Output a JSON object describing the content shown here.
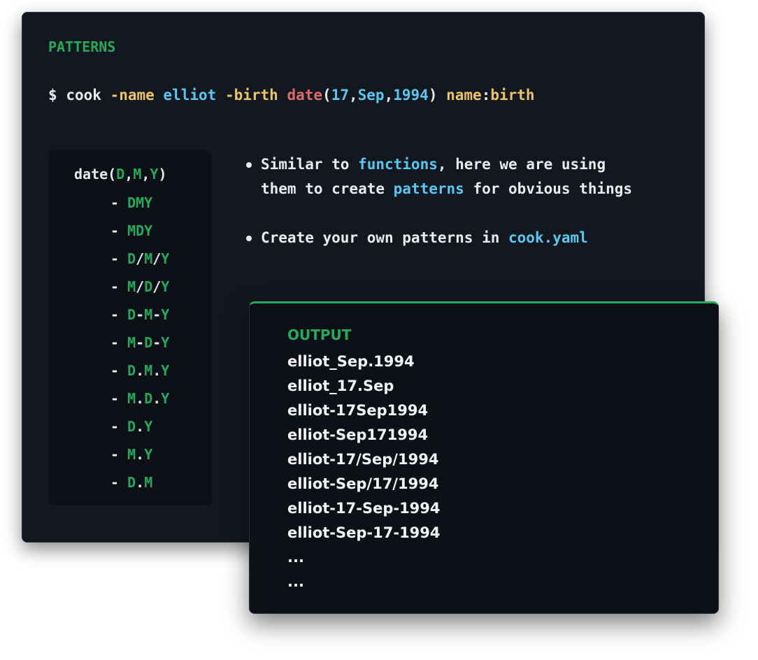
{
  "patterns_title": "PATTERNS",
  "command": {
    "prompt": "$",
    "cmd": "cook",
    "flag_name": "-name",
    "name_value": "elliot",
    "flag_birth": "-birth",
    "fn": "date",
    "open": "(",
    "day": "17",
    "comma1": ",",
    "month": "Sep",
    "comma2": ",",
    "year": "1994",
    "close": ")",
    "name_key": "name",
    "colon": ":",
    "birth_key": "birth"
  },
  "signature": {
    "fn": "date(",
    "d": "D",
    "comma1": ",",
    "m": "M",
    "comma2": ",",
    "y": "Y",
    "close": ")"
  },
  "patterns": [
    {
      "dash": "- ",
      "parts": [
        "DMY"
      ]
    },
    {
      "dash": "- ",
      "parts": [
        "MDY"
      ]
    },
    {
      "dash": "- ",
      "parts": [
        "D",
        "/",
        "M",
        "/",
        "Y"
      ]
    },
    {
      "dash": "- ",
      "parts": [
        "M",
        "/",
        "D",
        "/",
        "Y"
      ]
    },
    {
      "dash": "- ",
      "parts": [
        "D",
        "-",
        "M",
        "-",
        "Y"
      ]
    },
    {
      "dash": "- ",
      "parts": [
        "M",
        "-",
        "D",
        "-",
        "Y"
      ]
    },
    {
      "dash": "- ",
      "parts": [
        "D",
        ".",
        "M",
        ".",
        "Y"
      ]
    },
    {
      "dash": "- ",
      "parts": [
        "M",
        ".",
        "D",
        ".",
        "Y"
      ]
    },
    {
      "dash": "- ",
      "parts": [
        "D",
        ".",
        "Y"
      ]
    },
    {
      "dash": "- ",
      "parts": [
        "M",
        ".",
        "Y"
      ]
    },
    {
      "dash": "- ",
      "parts": [
        "D",
        ".",
        "M"
      ]
    }
  ],
  "bullets": {
    "b1": {
      "t1": "Similar to ",
      "h1": "functions",
      "t2": ", here we are using",
      "t3": "them to create ",
      "h2": "patterns",
      "t4": " for obvious things"
    },
    "b2": {
      "t1": "Create your own patterns in ",
      "h1": "cook.yaml"
    }
  },
  "output": {
    "title": "OUTPUT",
    "lines": [
      "elliot_Sep.1994",
      "elliot_17.Sep",
      "elliot-17Sep1994",
      "elliot-Sep171994",
      "elliot-17/Sep/1994",
      "elliot-Sep/17/1994",
      "elliot-17-Sep-1994",
      "elliot-Sep-17-1994",
      "...",
      "..."
    ]
  },
  "colors": {
    "background": "#131820",
    "code_background": "#0d1117",
    "green": "#27a95c",
    "yellow": "#e9c46a",
    "cyan": "#5bc6f0",
    "red": "#e06b6b",
    "text": "#e8eaed"
  }
}
